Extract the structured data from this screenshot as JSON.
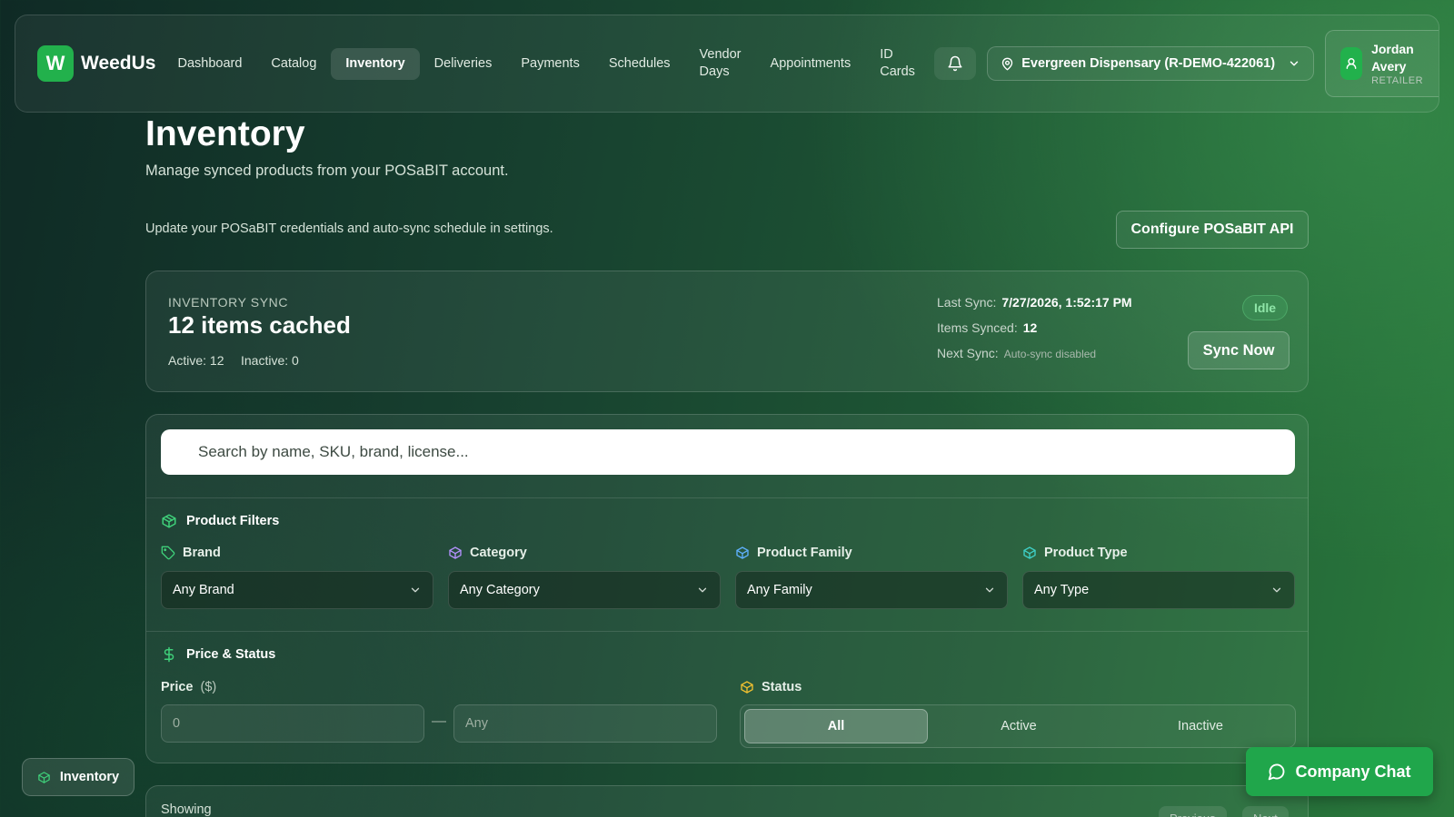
{
  "nav": {
    "logo_letter": "W",
    "brand": "WeedUs",
    "items": [
      {
        "label": "Dashboard"
      },
      {
        "label": "Catalog"
      },
      {
        "label": "Inventory"
      },
      {
        "label": "Deliveries"
      },
      {
        "label": "Payments"
      },
      {
        "label": "Schedules"
      },
      {
        "label": "Vendor Days"
      },
      {
        "label": "Appointments"
      },
      {
        "label": "ID Cards"
      }
    ],
    "location": "Evergreen Dispensary (R-DEMO-422061)",
    "user": {
      "name": "Jordan Avery",
      "role": "RETAILER"
    }
  },
  "header": {
    "title": "Inventory",
    "subtitle": "Manage synced products from your POSaBIT account.",
    "credentials_text": "Update your POSaBIT credentials and auto-sync schedule in settings.",
    "configure_button": "Configure POSaBIT API"
  },
  "sync": {
    "label": "INVENTORY SYNC",
    "count": "12 items cached",
    "active": "Active: 12",
    "inactive": "Inactive: 0",
    "last_sync_label": "Last Sync:",
    "last_sync_value": "7/27/2026, 1:52:17 PM",
    "items_synced_label": "Items Synced:",
    "items_synced_value": "12",
    "next_sync_label": "Next Sync:",
    "next_sync_value": "Auto-sync disabled",
    "status": "Idle",
    "sync_button": "Sync Now"
  },
  "filters": {
    "search_placeholder": "Search by name, SKU, brand, license...",
    "product_filters_title": "Product Filters",
    "brand_label": "Brand",
    "brand_value": "Any Brand",
    "category_label": "Category",
    "category_value": "Any Category",
    "family_label": "Product Family",
    "family_value": "Any Family",
    "type_label": "Product Type",
    "type_value": "Any Type",
    "price_status_title": "Price & Status",
    "price_label": "Price",
    "price_unit": "($)",
    "price_min_placeholder": "0",
    "price_max_placeholder": "Any",
    "dash": "—",
    "status_label": "Status",
    "status_options": [
      "All",
      "Active",
      "Inactive"
    ],
    "status_selected": "All"
  },
  "results": {
    "showing": "Showing",
    "prev": "Previous",
    "next": "Next"
  },
  "floating": {
    "inventory_badge": "Inventory",
    "chat_button": "Company Chat"
  },
  "colors": {
    "accent": "#22b14c",
    "chat": "#20a64b"
  }
}
